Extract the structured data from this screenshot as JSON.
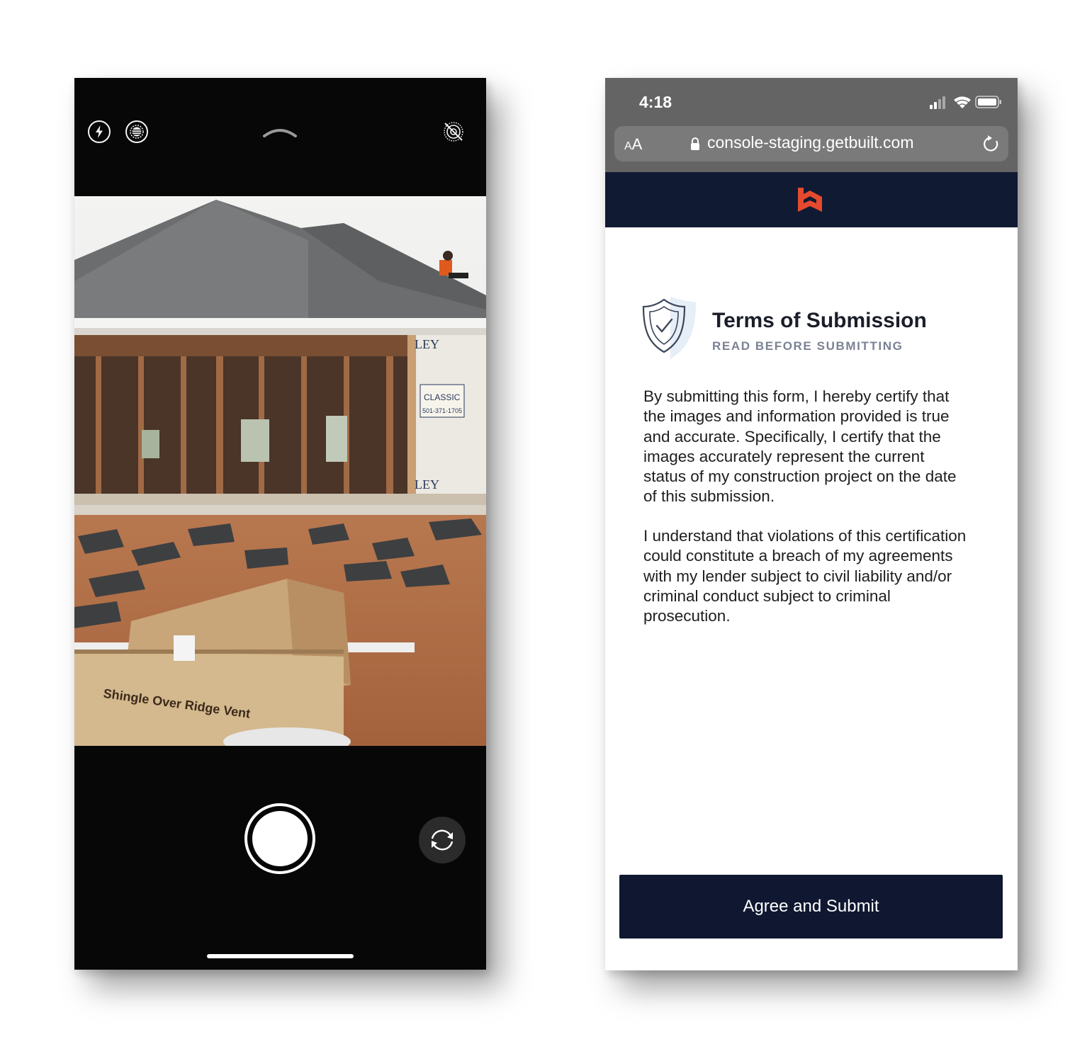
{
  "camera": {
    "icons": [
      "flash-icon",
      "live-photo-icon",
      "chevron-up-icon",
      "live-photo-off-icon",
      "shutter-button",
      "flip-camera-icon"
    ]
  },
  "browser": {
    "status_bar": {
      "time": "4:18"
    },
    "address_bar": {
      "text_size_label_small": "A",
      "text_size_label_large": "A",
      "url": "console-staging.getbuilt.com"
    },
    "brand": {
      "color": "#e64a2e",
      "header_color": "#111a33"
    },
    "terms": {
      "title": "Terms of Submission",
      "subtitle": "READ BEFORE SUBMITTING",
      "paragraph_1": "By submitting this form, I hereby certify that the images and information provided is true and accurate. Specifically, I certify that the images accurately represent the current status of my construction project on the date of this submission.",
      "paragraph_2": "I understand that violations of this certification could constitute a breach of my agreements with my lender subject to civil liability and/or criminal conduct subject to criminal prosecution."
    },
    "agree_button_label": "Agree and Submit",
    "button_color": "#0f1830"
  }
}
